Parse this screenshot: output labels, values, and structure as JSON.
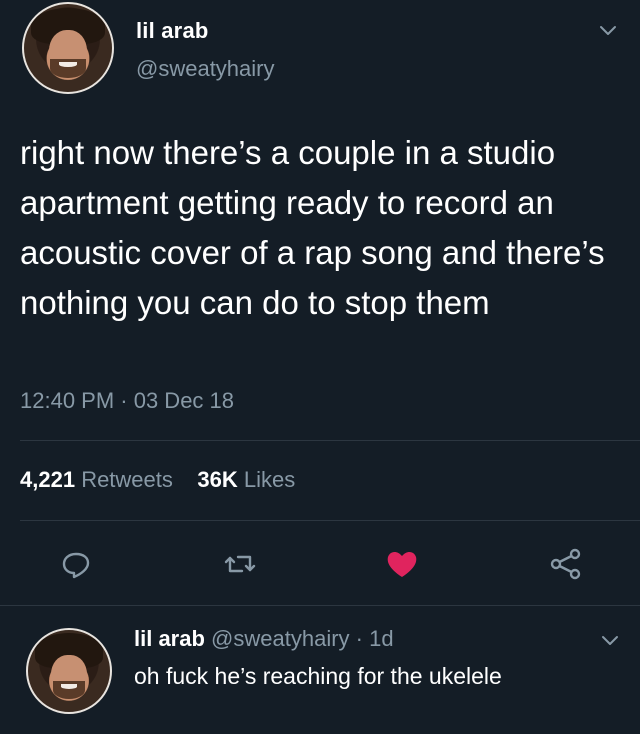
{
  "tweet": {
    "display_name": "lil arab",
    "handle": "@sweatyhairy",
    "text": "right now there’s a couple in a studio apartment getting ready to record an acoustic cover of a rap song and there’s nothing you can do to stop them",
    "timestamp": "12:40 PM · 03 Dec 18",
    "retweets_count": "4,221",
    "retweets_label": "Retweets",
    "likes_count": "36K",
    "likes_label": "Likes"
  },
  "reply": {
    "display_name": "lil arab",
    "handle": "@sweatyhairy",
    "meta": " · 1d",
    "text": "oh fuck he’s reaching for the ukelele"
  },
  "colors": {
    "background": "#141d26",
    "secondary_text": "#8899a6",
    "like_red": "#e0245e"
  },
  "icons": [
    "chevron-down-icon",
    "reply-icon",
    "retweet-icon",
    "heart-icon",
    "share-icon"
  ]
}
